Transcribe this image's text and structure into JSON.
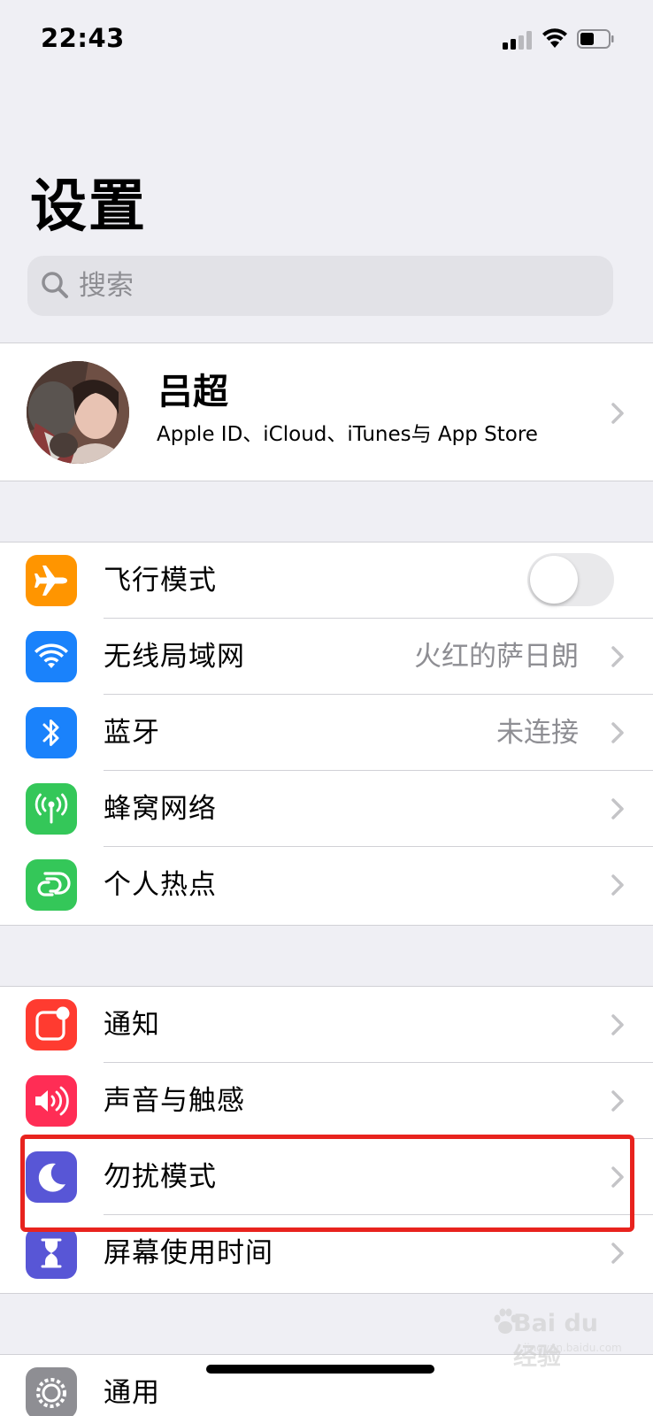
{
  "status_bar": {
    "time": "22:43"
  },
  "page_title": "设置",
  "search": {
    "placeholder": "搜索"
  },
  "profile": {
    "name": "吕超",
    "subtitle": "Apple ID、iCloud、iTunes与 App Store"
  },
  "connectivity": [
    {
      "label": "飞行模式",
      "icon": "airplane-icon",
      "color": "#ff9500",
      "toggle": false
    },
    {
      "label": "无线局域网",
      "icon": "wifi-icon",
      "color": "#1a82fb",
      "value": "火红的萨日朗"
    },
    {
      "label": "蓝牙",
      "icon": "bluetooth-icon",
      "color": "#1a82fb",
      "value": "未连接"
    },
    {
      "label": "蜂窝网络",
      "icon": "cellular-icon",
      "color": "#34c759"
    },
    {
      "label": "个人热点",
      "icon": "hotspot-icon",
      "color": "#34c759"
    }
  ],
  "notifications": [
    {
      "label": "通知",
      "icon": "notifications-icon",
      "color": "#ff3b30"
    },
    {
      "label": "声音与触感",
      "icon": "sound-icon",
      "color": "#ff2d55"
    },
    {
      "label": "勿扰模式",
      "icon": "moon-icon",
      "color": "#5856d6"
    },
    {
      "label": "屏幕使用时间",
      "icon": "hourglass-icon",
      "color": "#5856d6"
    }
  ],
  "general": [
    {
      "label": "通用",
      "icon": "gear-icon",
      "color": "#8e8e93"
    }
  ],
  "highlight_color": "#e8231e",
  "watermark": {
    "brand": "Bai du 经验",
    "url": "jingyan.baidu.com"
  }
}
